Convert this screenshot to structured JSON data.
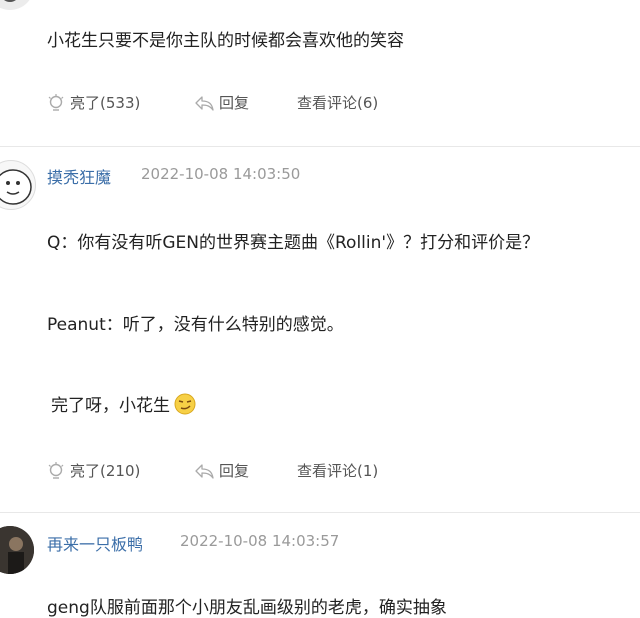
{
  "comments": [
    {
      "body": [
        "小花生只要不是你主队的时候都会喜欢他的笑容"
      ],
      "like_label": "亮了(533)",
      "reply_label": "回复",
      "view_replies_label": "查看评论(6)"
    },
    {
      "username": "摸秃狂魔",
      "timestamp": "2022-10-08 14:03:50",
      "body": [
        "Q：你有没有听GEN的世界赛主题曲《Rollin'》？打分和评价是？",
        "Peanut：听了，没有什么特别的感觉。",
        "完了呀，小花生"
      ],
      "emoji_icon": "smirk-emoji-icon",
      "like_label": "亮了(210)",
      "reply_label": "回复",
      "view_replies_label": "查看评论(1)"
    },
    {
      "username": "再来一只板鸭",
      "timestamp": "2022-10-08 14:03:57",
      "body": [
        "geng队服前面那个小朋友乱画级别的老虎，确实抽象"
      ]
    }
  ],
  "colors": {
    "username": "#3b6ea8",
    "timestamp": "#9a9a9a",
    "action": "#555555",
    "divider": "#e8e8e8"
  }
}
